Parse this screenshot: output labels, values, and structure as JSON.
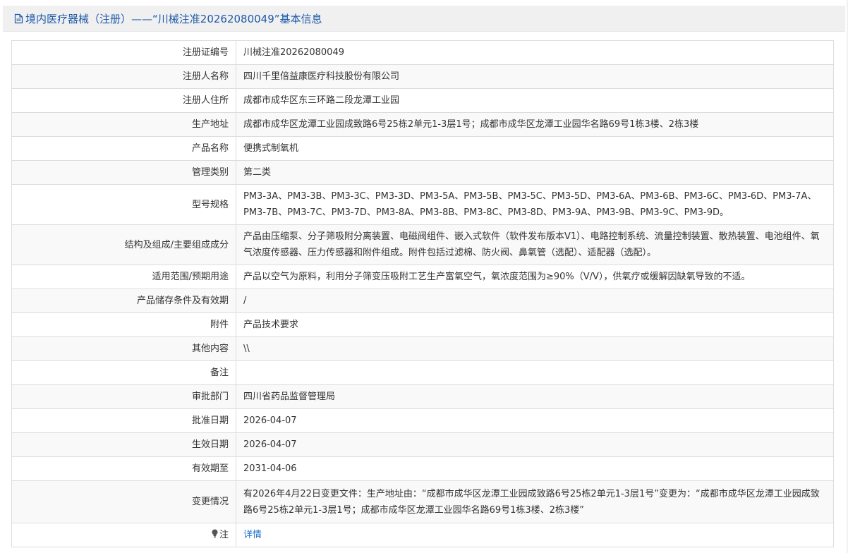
{
  "header": {
    "title": "境内医疗器械（注册）——“川械注准20262080049”基本信息",
    "icon": "document-icon"
  },
  "rows": [
    {
      "label": "注册证编号",
      "value": "川械注准20262080049"
    },
    {
      "label": "注册人名称",
      "value": "四川千里倍益康医疗科技股份有限公司"
    },
    {
      "label": "注册人住所",
      "value": "成都市成华区东三环路二段龙潭工业园"
    },
    {
      "label": "生产地址",
      "value": "成都市成华区龙潭工业园成致路6号25栋2单元1-3层1号；成都市成华区龙潭工业园华名路69号1栋3楼、2栋3楼"
    },
    {
      "label": "产品名称",
      "value": "便携式制氧机"
    },
    {
      "label": "管理类别",
      "value": "第二类"
    },
    {
      "label": "型号规格",
      "value": "PM3-3A、PM3-3B、PM3-3C、PM3-3D、PM3-5A、PM3-5B、PM3-5C、PM3-5D、PM3-6A、PM3-6B、PM3-6C、PM3-6D、PM3-7A、PM3-7B、PM3-7C、PM3-7D、PM3-8A、PM3-8B、PM3-8C、PM3-8D、PM3-9A、PM3-9B、PM3-9C、PM3-9D。"
    },
    {
      "label": "结构及组成/主要组成成分",
      "value": "产品由压缩泵、分子筛吸附分离装置、电磁阀组件、嵌入式软件（软件发布版本V1）、电路控制系统、流量控制装置、散热装置、电池组件、氧气浓度传感器、压力传感器和附件组成。附件包括过滤棉、防火阀、鼻氧管（选配）、适配器（选配）。"
    },
    {
      "label": "适用范围/预期用途",
      "value": "产品以空气为原料，利用分子筛变压吸附工艺生产富氧空气，氧浓度范围为≥90%（V/V），供氧疗或缓解因缺氧导致的不适。"
    },
    {
      "label": "产品储存条件及有效期",
      "value": "/"
    },
    {
      "label": "附件",
      "value": "产品技术要求"
    },
    {
      "label": "其他内容",
      "value": "\\\\"
    },
    {
      "label": "备注",
      "value": ""
    },
    {
      "label": "审批部门",
      "value": "四川省药品监督管理局"
    },
    {
      "label": "批准日期",
      "value": "2026-04-07"
    },
    {
      "label": "生效日期",
      "value": "2026-04-07"
    },
    {
      "label": "有效期至",
      "value": "2031-04-06"
    },
    {
      "label": "变更情况",
      "value": "有2026年4月22日变更文件：生产地址由：“成都市成华区龙潭工业园成致路6号25栋2单元1-3层1号”变更为：“成都市成华区龙潭工业园成致路6号25栋2单元1-3层1号；成都市成华区龙潭工业园华名路69号1栋3楼、2栋3楼”"
    }
  ],
  "note_row": {
    "label": "注",
    "icon": "lightbulb-icon",
    "link_text": "详情"
  },
  "colors": {
    "header_text": "#1e5aa8",
    "link": "#1e6fc8",
    "border": "#dddddd",
    "header_bg": "#f0f0f0"
  }
}
